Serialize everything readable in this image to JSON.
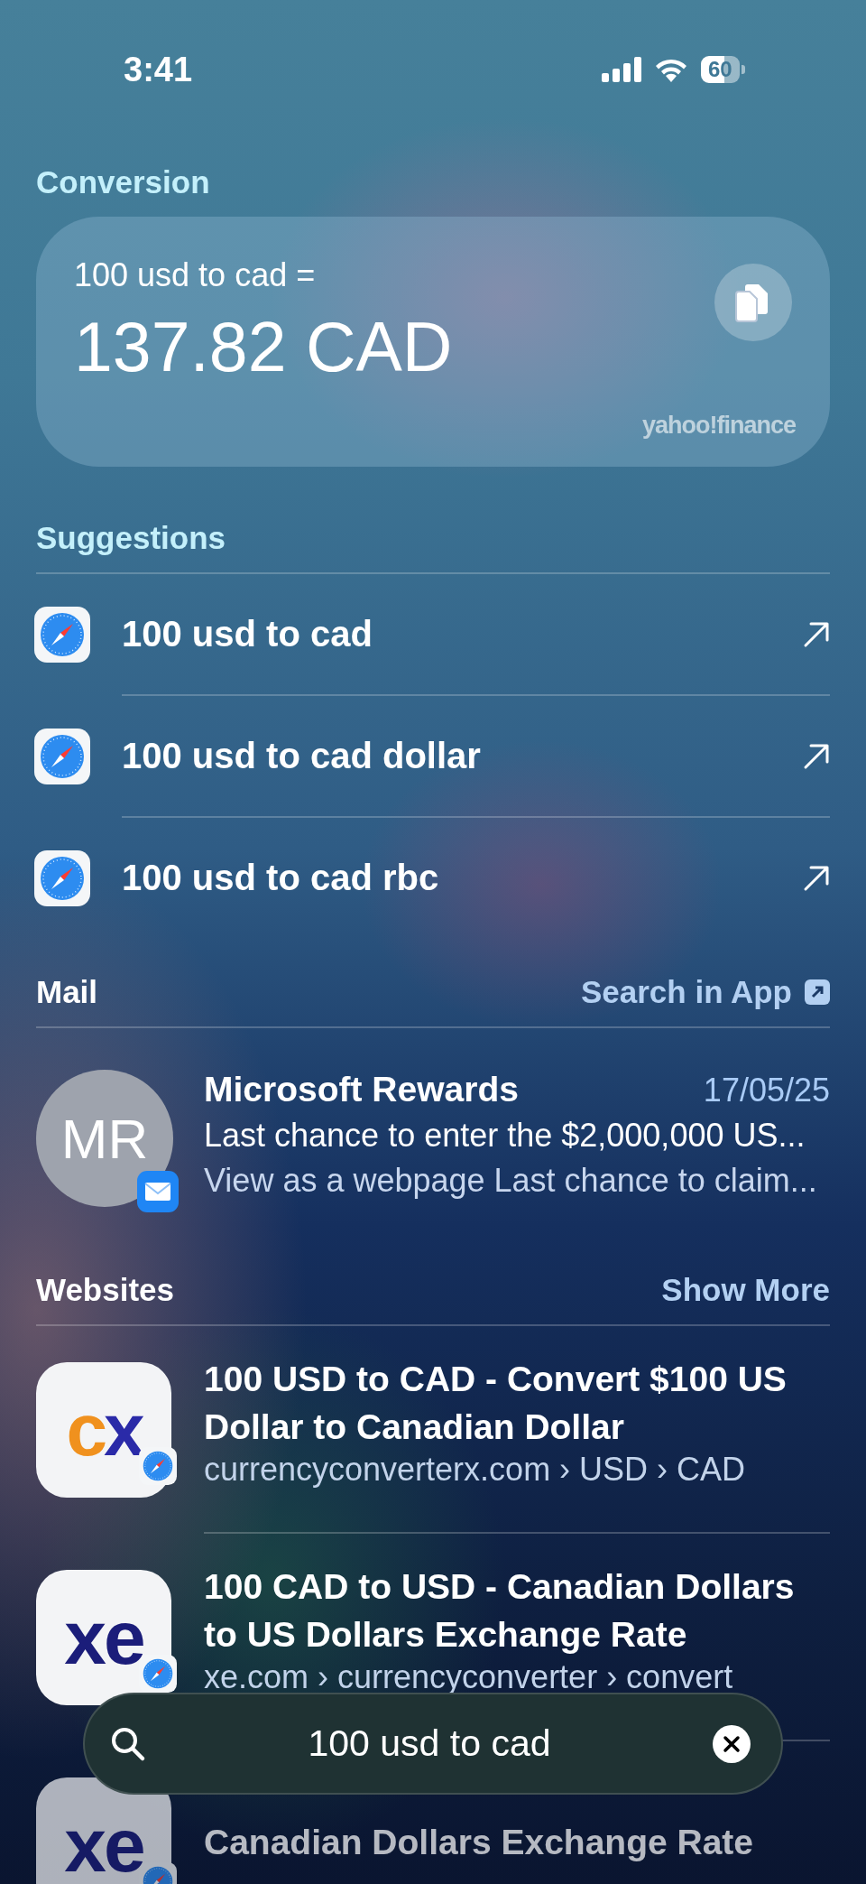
{
  "status_bar": {
    "time": "3:41",
    "battery": "60"
  },
  "conversion": {
    "heading": "Conversion",
    "query": "100 usd to cad =",
    "result": "137.82 CAD",
    "source": "yahoo!finance"
  },
  "suggestions": {
    "heading": "Suggestions",
    "items": [
      {
        "label": "100 usd to cad"
      },
      {
        "label": "100 usd to cad dollar"
      },
      {
        "label": "100 usd to cad rbc"
      }
    ]
  },
  "mail": {
    "heading": "Mail",
    "action": "Search in App",
    "items": [
      {
        "initials": "MR",
        "sender": "Microsoft Rewards",
        "date": "17/05/25",
        "subject": "Last chance to enter the $2,000,000 US...",
        "preview": "View as a webpage Last chance to claim..."
      }
    ]
  },
  "websites": {
    "heading": "Websites",
    "action": "Show More",
    "items": [
      {
        "logo": "cx",
        "title": "100 USD to CAD - Convert $100 US Dollar to Canadian Dollar",
        "url": "currencyconverterx.com › USD › CAD"
      },
      {
        "logo": "xe",
        "title": "100 CAD to USD - Canadian Dollars to US Dollars Exchange Rate",
        "url": "xe.com › currencyconverter › convert"
      },
      {
        "logo": "xe",
        "title": "Canadian Dollars Exchange Rate"
      }
    ]
  },
  "search": {
    "value": "100 usd to cad"
  }
}
